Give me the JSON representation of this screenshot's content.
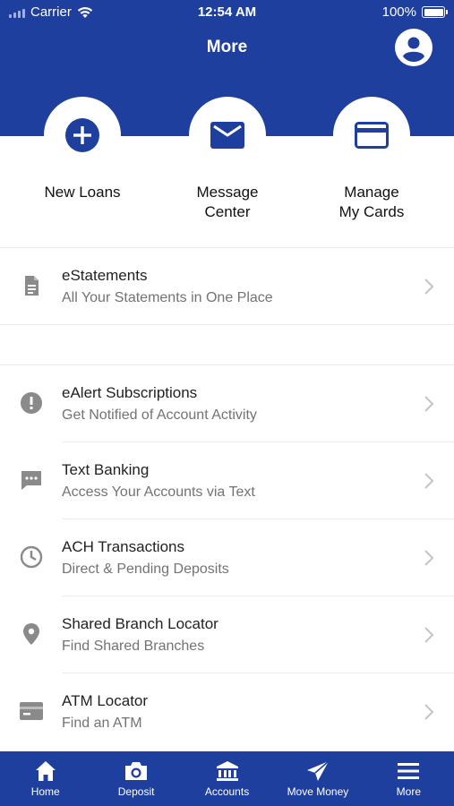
{
  "status_bar": {
    "carrier": "Carrier",
    "time": "12:54 AM",
    "battery": "100%"
  },
  "header": {
    "title": "More",
    "profile_icon": "user-circle-icon"
  },
  "quick_actions": [
    {
      "label": "New Loans",
      "icon": "plus-circle-icon"
    },
    {
      "label": "Message\nCenter",
      "icon": "envelope-icon"
    },
    {
      "label": "Manage\nMy Cards",
      "icon": "credit-card-icon"
    }
  ],
  "menu_groups": [
    [
      {
        "title": "eStatements",
        "subtitle": "All Your Statements in One Place",
        "icon": "document-icon"
      }
    ],
    [
      {
        "title": "eAlert Subscriptions",
        "subtitle": "Get Notified of Account Activity",
        "icon": "alert-icon"
      },
      {
        "title": "Text Banking",
        "subtitle": "Access Your Accounts via Text",
        "icon": "chat-icon"
      },
      {
        "title": "ACH Transactions",
        "subtitle": "Direct & Pending Deposits",
        "icon": "clock-icon"
      },
      {
        "title": "Shared Branch Locator",
        "subtitle": "Find Shared Branches",
        "icon": "location-pin-icon"
      },
      {
        "title": "ATM Locator",
        "subtitle": "Find an ATM",
        "icon": "atm-card-icon"
      }
    ]
  ],
  "tab_bar": [
    {
      "label": "Home",
      "icon": "home-icon"
    },
    {
      "label": "Deposit",
      "icon": "camera-icon"
    },
    {
      "label": "Accounts",
      "icon": "bank-icon"
    },
    {
      "label": "Move Money",
      "icon": "paper-plane-icon"
    },
    {
      "label": "More",
      "icon": "menu-icon"
    }
  ],
  "colors": {
    "brand": "#1f3f9e",
    "icon_gray": "#8a8a8a"
  }
}
